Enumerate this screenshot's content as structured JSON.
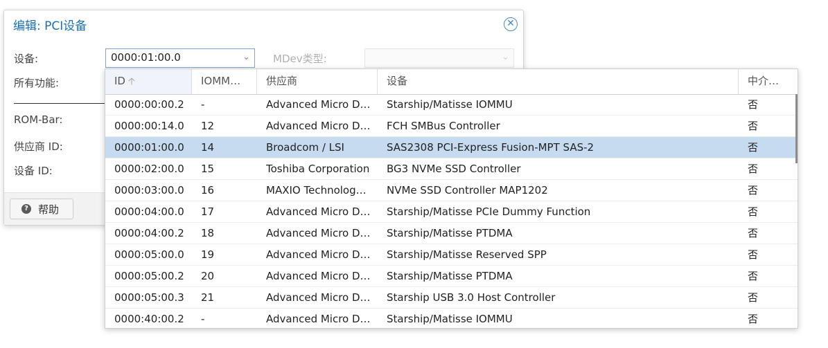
{
  "dialog": {
    "title": "编辑: PCI设备",
    "close_icon": "close-icon",
    "labels": {
      "device": "设备:",
      "all_functions": "所有功能:",
      "rom_bar": "ROM-Bar:",
      "vendor_id": "供应商 ID:",
      "device_id": "设备 ID:",
      "mdev_type": "MDev类型:"
    },
    "device_value": "0000:01:00.0",
    "help_label": "帮助",
    "help_icon": "question-icon"
  },
  "grid": {
    "columns": [
      "ID",
      "IOMM…",
      "供应商",
      "设备",
      "中介…"
    ],
    "sorted_column": "ID",
    "sort_direction": "asc",
    "selected_row": 2,
    "rows": [
      {
        "id": "0000:00:00.2",
        "iommu": "-",
        "vendor": "Advanced Micro D…",
        "device": "Starship/Matisse IOMMU",
        "mediated": "否"
      },
      {
        "id": "0000:00:14.0",
        "iommu": "12",
        "vendor": "Advanced Micro D…",
        "device": "FCH SMBus Controller",
        "mediated": "否"
      },
      {
        "id": "0000:01:00.0",
        "iommu": "14",
        "vendor": "Broadcom / LSI",
        "device": "SAS2308 PCI-Express Fusion-MPT SAS-2",
        "mediated": "否"
      },
      {
        "id": "0000:02:00.0",
        "iommu": "15",
        "vendor": "Toshiba Corporation",
        "device": "BG3 NVMe SSD Controller",
        "mediated": "否"
      },
      {
        "id": "0000:03:00.0",
        "iommu": "16",
        "vendor": "MAXIO Technolog…",
        "device": "NVMe SSD Controller MAP1202",
        "mediated": "否"
      },
      {
        "id": "0000:04:00.0",
        "iommu": "17",
        "vendor": "Advanced Micro D…",
        "device": "Starship/Matisse PCIe Dummy Function",
        "mediated": "否"
      },
      {
        "id": "0000:04:00.2",
        "iommu": "18",
        "vendor": "Advanced Micro D…",
        "device": "Starship/Matisse PTDMA",
        "mediated": "否"
      },
      {
        "id": "0000:05:00.0",
        "iommu": "19",
        "vendor": "Advanced Micro D…",
        "device": "Starship/Matisse Reserved SPP",
        "mediated": "否"
      },
      {
        "id": "0000:05:00.2",
        "iommu": "20",
        "vendor": "Advanced Micro D…",
        "device": "Starship/Matisse PTDMA",
        "mediated": "否"
      },
      {
        "id": "0000:05:00.3",
        "iommu": "21",
        "vendor": "Advanced Micro D…",
        "device": "Starship USB 3.0 Host Controller",
        "mediated": "否"
      },
      {
        "id": "0000:40:00.2",
        "iommu": "-",
        "vendor": "Advanced Micro D…",
        "device": "Starship/Matisse IOMMU",
        "mediated": "否"
      }
    ]
  },
  "colors": {
    "title": "#1a6fb5",
    "selected_row": "#c6dbf0",
    "combo_border": "#7da5cf"
  }
}
